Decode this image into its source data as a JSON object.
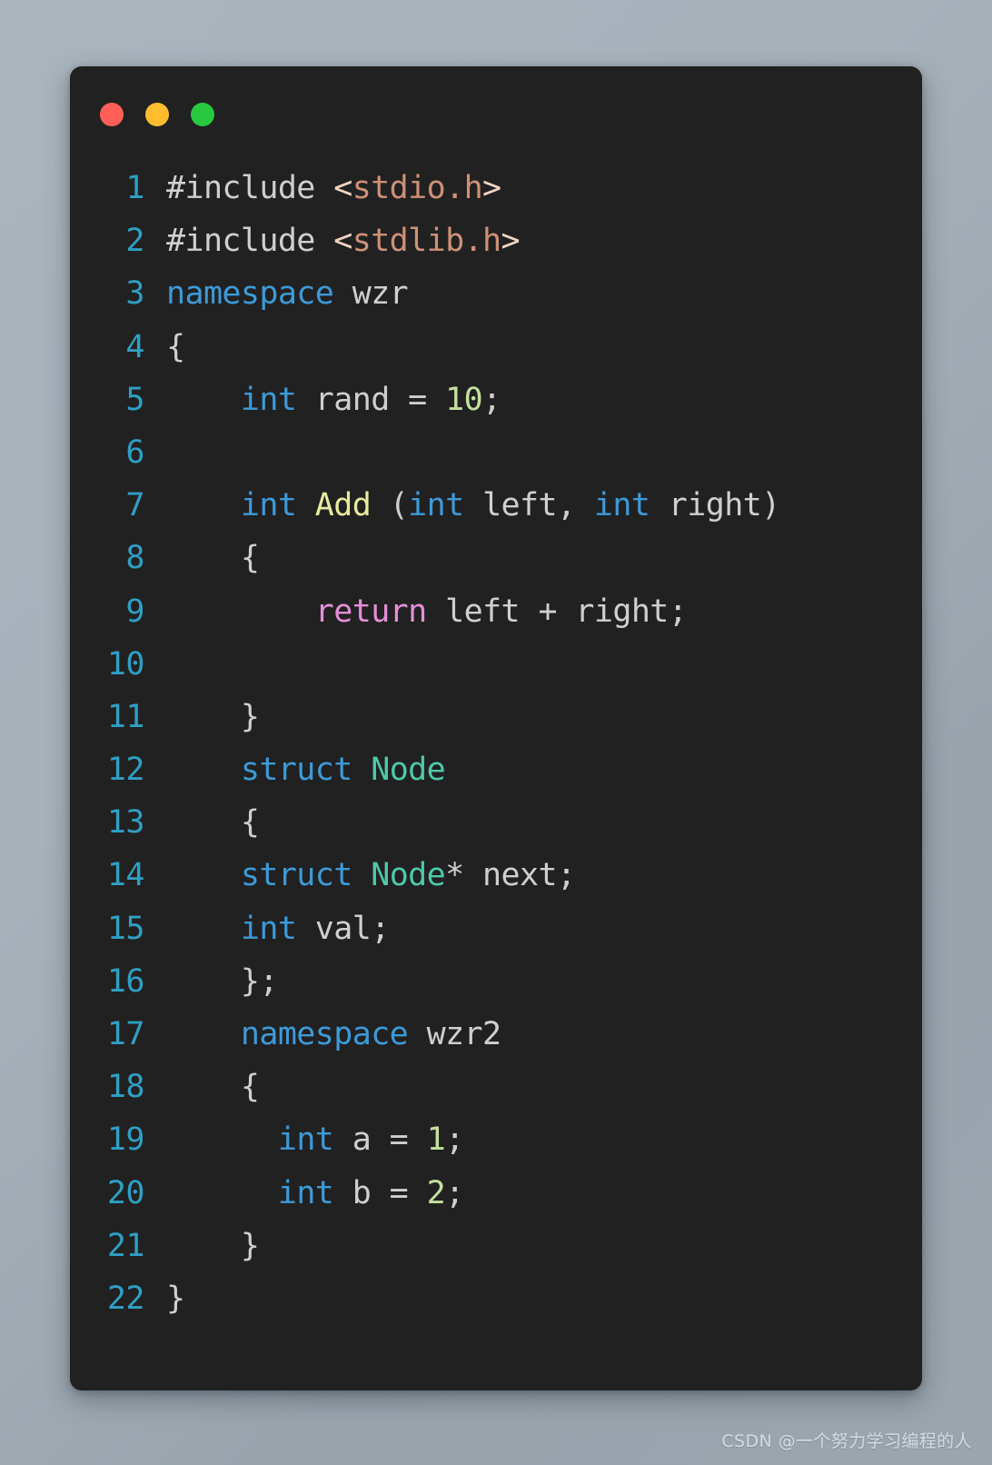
{
  "window": {
    "controls": [
      {
        "name": "close",
        "color": "#ff5f56"
      },
      {
        "name": "minimize",
        "color": "#ffbd2e"
      },
      {
        "name": "maximize",
        "color": "#27c93f"
      }
    ],
    "background_color": "#212121",
    "page_background": "#a9b4bd"
  },
  "editor": {
    "language": "C++",
    "line_number_color": "#2f9fc4",
    "default_text_color": "#cfcfcf",
    "lines": [
      {
        "n": "1",
        "tokens": [
          {
            "t": "#include ",
            "c": "t-plain"
          },
          {
            "t": "<",
            "c": "t-angle"
          },
          {
            "t": "stdio.h",
            "c": "t-str"
          },
          {
            "t": ">",
            "c": "t-angle"
          }
        ]
      },
      {
        "n": "2",
        "tokens": [
          {
            "t": "#include ",
            "c": "t-plain"
          },
          {
            "t": "<",
            "c": "t-angle"
          },
          {
            "t": "stdlib.h",
            "c": "t-str"
          },
          {
            "t": ">",
            "c": "t-angle"
          }
        ]
      },
      {
        "n": "3",
        "tokens": [
          {
            "t": "namespace",
            "c": "t-kw"
          },
          {
            "t": " wzr",
            "c": "t-plain"
          }
        ]
      },
      {
        "n": "4",
        "tokens": [
          {
            "t": "{",
            "c": "t-punct"
          }
        ]
      },
      {
        "n": "5",
        "tokens": [
          {
            "t": "    ",
            "c": "t-plain"
          },
          {
            "t": "int",
            "c": "t-kw"
          },
          {
            "t": " rand = ",
            "c": "t-plain"
          },
          {
            "t": "10",
            "c": "t-num"
          },
          {
            "t": ";",
            "c": "t-punct"
          }
        ]
      },
      {
        "n": "6",
        "tokens": []
      },
      {
        "n": "7",
        "tokens": [
          {
            "t": "    ",
            "c": "t-plain"
          },
          {
            "t": "int",
            "c": "t-kw"
          },
          {
            "t": " ",
            "c": "t-plain"
          },
          {
            "t": "Add",
            "c": "t-func"
          },
          {
            "t": " (",
            "c": "t-punct"
          },
          {
            "t": "int",
            "c": "t-kw"
          },
          {
            "t": " left, ",
            "c": "t-plain"
          },
          {
            "t": "int",
            "c": "t-kw"
          },
          {
            "t": " right)",
            "c": "t-plain"
          }
        ]
      },
      {
        "n": "8",
        "tokens": [
          {
            "t": "    {",
            "c": "t-punct"
          }
        ]
      },
      {
        "n": "9",
        "tokens": [
          {
            "t": "        ",
            "c": "t-plain"
          },
          {
            "t": "return",
            "c": "t-ret"
          },
          {
            "t": " left + right;",
            "c": "t-plain"
          }
        ]
      },
      {
        "n": "10",
        "tokens": []
      },
      {
        "n": "11",
        "tokens": [
          {
            "t": "    }",
            "c": "t-punct"
          }
        ]
      },
      {
        "n": "12",
        "tokens": [
          {
            "t": "    ",
            "c": "t-plain"
          },
          {
            "t": "struct",
            "c": "t-kw"
          },
          {
            "t": " ",
            "c": "t-plain"
          },
          {
            "t": "Node",
            "c": "t-type"
          }
        ]
      },
      {
        "n": "13",
        "tokens": [
          {
            "t": "    {",
            "c": "t-punct"
          }
        ]
      },
      {
        "n": "14",
        "tokens": [
          {
            "t": "   ",
            "c": "t-plain"
          },
          {
            "t": " struct",
            "c": "t-kw"
          },
          {
            "t": " ",
            "c": "t-plain"
          },
          {
            "t": "Node",
            "c": "t-type"
          },
          {
            "t": "* next;",
            "c": "t-plain"
          }
        ]
      },
      {
        "n": "15",
        "tokens": [
          {
            "t": "    ",
            "c": "t-plain"
          },
          {
            "t": "int",
            "c": "t-kw"
          },
          {
            "t": " val;",
            "c": "t-plain"
          }
        ]
      },
      {
        "n": "16",
        "tokens": [
          {
            "t": "    };",
            "c": "t-punct"
          }
        ]
      },
      {
        "n": "17",
        "tokens": [
          {
            "t": "    ",
            "c": "t-plain"
          },
          {
            "t": "namespace",
            "c": "t-kw"
          },
          {
            "t": " wzr2",
            "c": "t-plain"
          }
        ]
      },
      {
        "n": "18",
        "tokens": [
          {
            "t": "    {",
            "c": "t-punct"
          }
        ]
      },
      {
        "n": "19",
        "tokens": [
          {
            "t": "      ",
            "c": "t-plain"
          },
          {
            "t": "int",
            "c": "t-kw"
          },
          {
            "t": " a = ",
            "c": "t-plain"
          },
          {
            "t": "1",
            "c": "t-num"
          },
          {
            "t": ";",
            "c": "t-punct"
          }
        ]
      },
      {
        "n": "20",
        "tokens": [
          {
            "t": "      ",
            "c": "t-plain"
          },
          {
            "t": "int",
            "c": "t-kw"
          },
          {
            "t": " b = ",
            "c": "t-plain"
          },
          {
            "t": "2",
            "c": "t-num"
          },
          {
            "t": ";",
            "c": "t-punct"
          }
        ]
      },
      {
        "n": "21",
        "tokens": [
          {
            "t": "    }",
            "c": "t-punct"
          }
        ]
      },
      {
        "n": "22",
        "tokens": [
          {
            "t": "}",
            "c": "t-punct"
          }
        ]
      }
    ]
  },
  "watermark": {
    "text": "CSDN @一个努力学习编程的人"
  }
}
